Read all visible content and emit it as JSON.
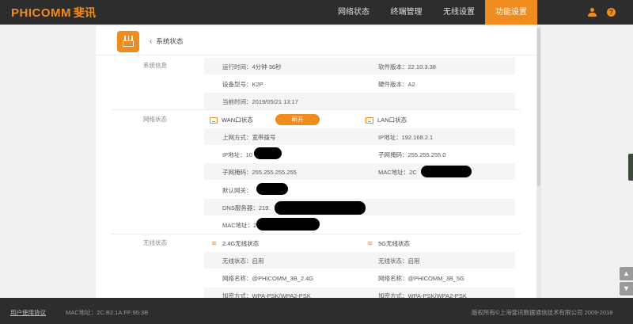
{
  "brand": {
    "name_en": "PHICOMM",
    "name_cn": "斐讯",
    "accent": "#f08c1e"
  },
  "nav": {
    "items": [
      {
        "label": "网络状态"
      },
      {
        "label": "终端管理"
      },
      {
        "label": "无线设置"
      },
      {
        "label": "功能设置",
        "active": true
      }
    ]
  },
  "top_icons": {
    "admin": "admin-icon",
    "help": "help-icon",
    "help_glyph": "?"
  },
  "page": {
    "back_label": "系统状态",
    "back_glyph": "‹"
  },
  "system_info": {
    "section_label": "系统信息",
    "uptime": "运行时间：4分钟 36秒",
    "software_version": "软件版本：22.10.3.38",
    "device_model": "设备型号：K2P",
    "hardware_version": "硬件版本：A2",
    "current_time": "当前时间：2019/05/21 13:17"
  },
  "network_status": {
    "section_label": "网络状态",
    "wan": {
      "title": "WAN口状态",
      "status_button": "断开",
      "access_mode": "上网方式：宽带拨号",
      "ip": "IP地址：10",
      "subnet": "子网掩码：255.255.255.255",
      "gateway": "默认网关：",
      "dns": "DNS服务器：219.",
      "mac": "MAC地址：2C"
    },
    "lan": {
      "title": "LAN口状态",
      "ip": "IP地址：192.168.2.1",
      "subnet": "子网掩码：255.255.255.0",
      "mac": "MAC地址：2C"
    }
  },
  "wireless_status": {
    "section_label": "无线状态",
    "band_24": {
      "title": "2.4G无线状态",
      "state": "无线状态：启用",
      "ssid": "网络名称：@PHICOMM_3B_2.4G",
      "encryption": "加密方式：WPA-PSK/WPA2-PSK"
    },
    "band_5": {
      "title": "5G无线状态",
      "state": "无线状态：启用",
      "ssid": "网络名称：@PHICOMM_3B_5G",
      "encryption": "加密方式：WPA-PSK/WPA2-PSK"
    }
  },
  "footer": {
    "agreement_link": "用户使用协议",
    "mac": "MAC地址：2C:B2:1A:FF:95:3B",
    "copyright": "版权所有©上海斐讯数据通信技术有限公司 2009-2018"
  },
  "float_buttons": {
    "top_glyph": "▲",
    "bottom_glyph": "▼"
  }
}
